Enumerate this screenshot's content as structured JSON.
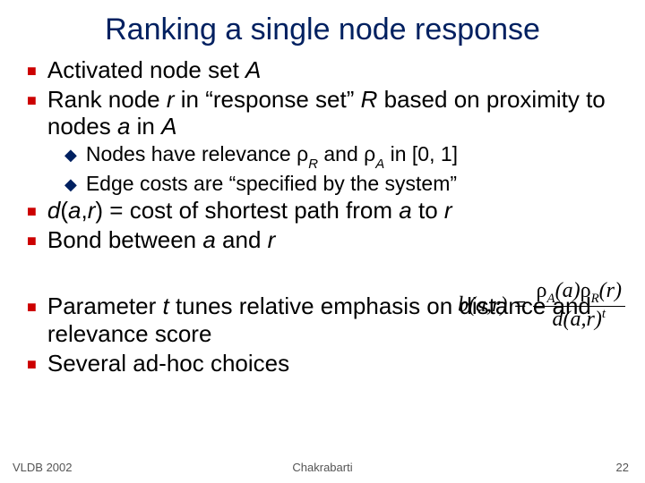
{
  "title": "Ranking a single node response",
  "bullets": {
    "b1": {
      "pre": "Activated node set ",
      "A": "A"
    },
    "b2": {
      "pre": "Rank node ",
      "r": "r",
      "mid1": "  in “response set” ",
      "R": "R",
      "mid2": "  based on proximity to nodes ",
      "a": "a",
      "mid3": "  in ",
      "A": "A"
    },
    "s1": {
      "pre": "Nodes have relevance ",
      "rho1": "ρ",
      "sub1": "R",
      "and": " and ",
      "rho2": "ρ",
      "sub2": "A",
      "post": " in [0, 1]"
    },
    "s2": "Edge costs are “specified by the system”",
    "b3": {
      "d": "d",
      "paren": "(",
      "a": "a",
      "comma": ",",
      "r": "r",
      "close": ")",
      "eq": " = cost of shortest path from ",
      "a2": "a",
      "to": "  to ",
      "r2": "r"
    },
    "b4": {
      "pre": "Bond between ",
      "a": "a",
      "and": " and ",
      "r": "r"
    },
    "b5": {
      "pre": "Parameter ",
      "t": "t",
      "post": "  tunes relative emphasis on distance and relevance score"
    },
    "b6": "Several ad-hoc choices"
  },
  "formula": {
    "lhs": "b(a,r) =",
    "num": {
      "rhoA": "ρ",
      "subA": "A",
      "argA": "(a)",
      "rhoR": "ρ",
      "subR": "R",
      "argR": "(r)"
    },
    "den": {
      "d": "d(a,r)",
      "t": "t"
    }
  },
  "footer": {
    "left": "VLDB 2002",
    "center": "Chakrabarti",
    "right": "22"
  }
}
